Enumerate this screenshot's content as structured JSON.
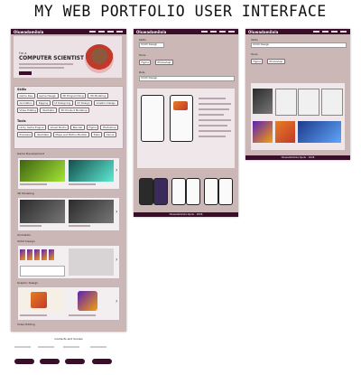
{
  "page": {
    "title": "MY WEB PORTFOLIO USER INTERFACE"
  },
  "brand": {
    "name": "Oluwadamilola",
    "accent": "#3a0d2a",
    "bg": "#cbb8b6"
  },
  "hero": {
    "subtitle": "I'm a",
    "headline": "COMPUTER SCIENTIST"
  },
  "skills": {
    "heading": "Skills",
    "items": [
      "Game Dev",
      "Game Design",
      "3D Programming",
      "3D Modeling",
      "Animation",
      "Rigging",
      "UI Designing",
      "UX Design",
      "Graphic Design",
      "Video Editing",
      "Illustrator",
      "3D Product Modeling"
    ]
  },
  "tools": {
    "heading": "Tools",
    "items": [
      "Unity Game Engine",
      "Visual Studio",
      "Blender",
      "Figma",
      "Photoshop",
      "Premiere",
      "Illustrator",
      "Maya and Motion Builder",
      "Trello",
      "Canva"
    ]
  },
  "sections": [
    "Game Development",
    "3D Modeling",
    "Animation",
    "UI/UX Design",
    "Graphic Design",
    "Video Editing"
  ],
  "detail": {
    "skills_label": "Skills",
    "skills_value": "UI/UX Design",
    "tools_label": "Tools",
    "tools": [
      "Figma",
      "Photoshop"
    ],
    "role_label": "Role",
    "role_value": "UI/UX Design"
  },
  "footer": {
    "text": "Oluwadamilola Ojudu  ·  2026"
  },
  "contact": {
    "title": "Contacts and Socials"
  }
}
